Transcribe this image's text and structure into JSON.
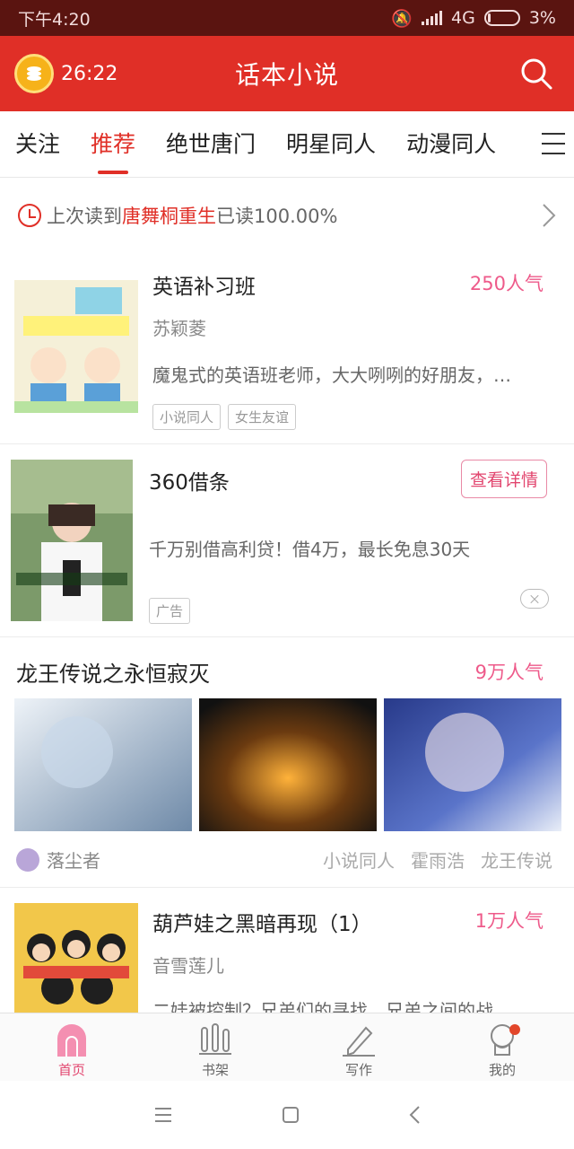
{
  "status_bar": {
    "time": "下午4:20",
    "network": "4G",
    "battery": "3%"
  },
  "header": {
    "timer": "26:22",
    "title": "话本小说"
  },
  "tabs": [
    {
      "label": "关注"
    },
    {
      "label": "推荐"
    },
    {
      "label": "绝世唐门"
    },
    {
      "label": "明星同人"
    },
    {
      "label": "动漫同人"
    }
  ],
  "last_read": {
    "prefix": "上次读到",
    "book": "唐舞桐重生",
    "suffix": "已读100.00%"
  },
  "feed": {
    "book1": {
      "title": "英语补习班",
      "popularity": "250人气",
      "author": "苏颖菱",
      "desc": "魔鬼式的英语班老师，大大咧咧的好朋友，…",
      "tags": [
        "小说同人",
        "女生友谊"
      ]
    },
    "ad": {
      "title": "360借条",
      "button": "查看详情",
      "desc": "千万别借高利贷！借4万，最长免息30天",
      "tag": "广告"
    },
    "post": {
      "title": "龙王传说之永恒寂灭",
      "popularity": "9万人气",
      "author": "落尘者",
      "tags": [
        "小说同人",
        "霍雨浩",
        "龙王传说"
      ]
    },
    "book2": {
      "title": "葫芦娃之黑暗再现（1）",
      "popularity": "1万人气",
      "author": "音雪莲儿",
      "desc": "二娃被控制？兄弟们的寻找，兄弟之间的战…"
    }
  },
  "bottom_nav": [
    {
      "label": "首页",
      "icon": "home-icon"
    },
    {
      "label": "书架",
      "icon": "bookshelf-icon"
    },
    {
      "label": "写作",
      "icon": "pen-icon"
    },
    {
      "label": "我的",
      "icon": "profile-icon"
    }
  ],
  "colors": {
    "brand": "#e02f27",
    "accent_pink": "#ee5a8a"
  }
}
